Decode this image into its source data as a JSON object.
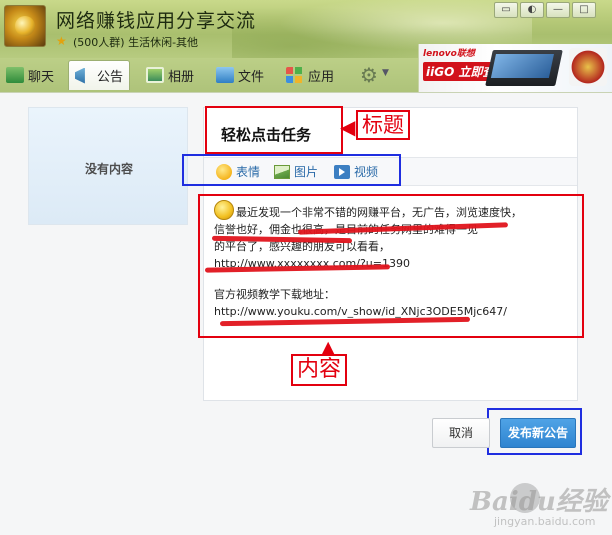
{
  "window": {
    "group_name": "网络赚钱应用分享交流",
    "group_meta": "(500人群) 生活休闲-其他"
  },
  "tabs": [
    {
      "label": "聊天",
      "icon": "chat-icon"
    },
    {
      "label": "公告",
      "icon": "notice-icon",
      "active": true
    },
    {
      "label": "相册",
      "icon": "album-icon"
    },
    {
      "label": "文件",
      "icon": "file-icon"
    },
    {
      "label": "应用",
      "icon": "app-icon"
    }
  ],
  "ad": {
    "brand": "lenovo联想",
    "tagline": "iiGO 立即查阅"
  },
  "left_card": {
    "empty_text": "没有内容"
  },
  "editor": {
    "title": "轻松点击任务",
    "toolbar": {
      "emoji": "表情",
      "image": "图片",
      "video": "视频"
    },
    "content": {
      "line1": "最近发现一个非常不错的网赚平台，无广告，浏览速度快，",
      "line2": "信誉也好，佣金也很高，是目前的任务网里的难得一见",
      "line3": "的平台了，感兴趣的朋友可以看看，",
      "line4": "http://www.xxxxxxxx.com/?u=1390",
      "line5": "官方视频教学下载地址：",
      "line6": "http://www.youku.com/v_show/id_XNjc3ODE5Mjc647/"
    }
  },
  "buttons": {
    "cancel": "取消",
    "publish": "发布新公告"
  },
  "annotations": {
    "title_label": "标题",
    "content_label": "内容"
  },
  "watermark": {
    "logo": "Baidu经验",
    "url": "jingyan.baidu.com"
  },
  "colors": {
    "annotation_red": "#e3000f",
    "annotation_blue": "#1f2ee0",
    "publish_blue": "#2f84d0"
  }
}
